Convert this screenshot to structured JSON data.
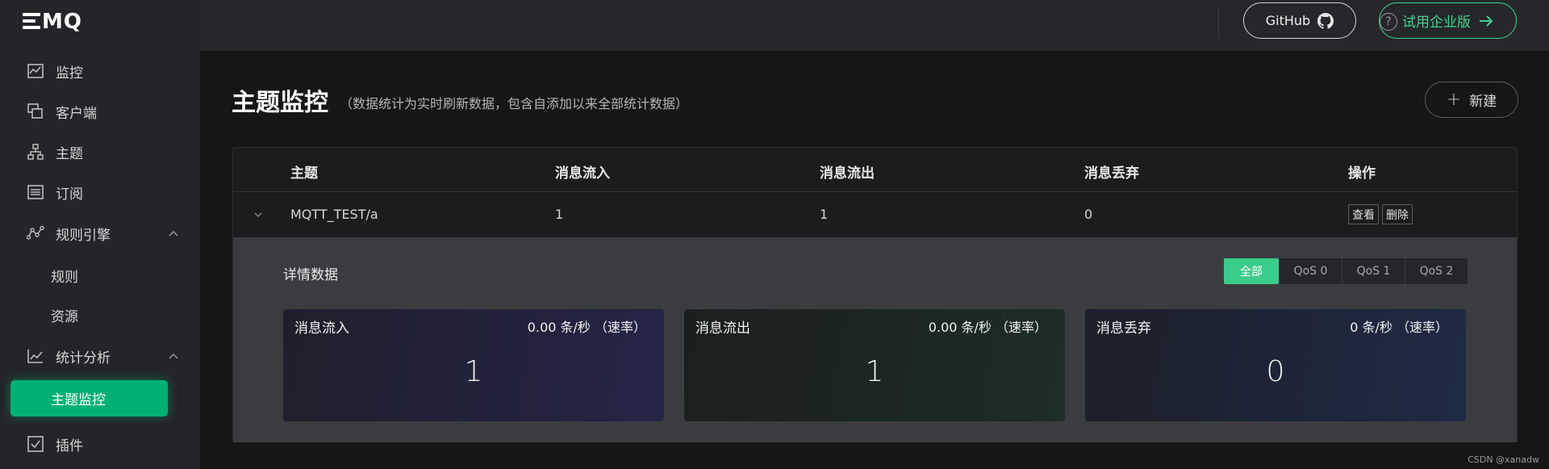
{
  "brand": {
    "logo_text": "MQ"
  },
  "sidebar": {
    "items": [
      {
        "label": "监控",
        "icon": "monitor-chart-icon"
      },
      {
        "label": "客户端",
        "icon": "clients-icon"
      },
      {
        "label": "主题",
        "icon": "topic-tree-icon"
      },
      {
        "label": "订阅",
        "icon": "subscription-list-icon"
      },
      {
        "label": "规则引擎",
        "icon": "rule-engine-icon",
        "expanded": true,
        "children": [
          {
            "label": "规则"
          },
          {
            "label": "资源"
          }
        ]
      },
      {
        "label": "统计分析",
        "icon": "statistics-chart-icon",
        "expanded": true,
        "children": [
          {
            "label": "主题监控",
            "active": true
          }
        ]
      },
      {
        "label": "插件",
        "icon": "plugin-checkbox-icon"
      }
    ]
  },
  "header": {
    "help_icon": "?",
    "github_label": "GitHub",
    "enterprise_label": "试用企业版"
  },
  "page": {
    "title": "主题监控",
    "subtitle": "（数据统计为实时刷新数据，包含自添加以来全部统计数据）",
    "new_button": "新建"
  },
  "table": {
    "columns": [
      "主题",
      "消息流入",
      "消息流出",
      "消息丢弃",
      "操作"
    ],
    "rows": [
      {
        "topic": "MQTT_TEST/a",
        "in": "1",
        "out": "1",
        "dropped": "0",
        "actions": [
          "查看",
          "删除"
        ]
      }
    ]
  },
  "detail": {
    "title": "详情数据",
    "qos_tabs": [
      "全部",
      "QoS 0",
      "QoS 1",
      "QoS 2"
    ],
    "selected_qos": "全部",
    "cards": [
      {
        "title": "消息流入",
        "rate": "0.00 条/秒 （速率）",
        "value": "1"
      },
      {
        "title": "消息流出",
        "rate": "0.00 条/秒 （速率）",
        "value": "1"
      },
      {
        "title": "消息丢弃",
        "rate": "0 条/秒 （速率）",
        "value": "0"
      }
    ]
  },
  "colors": {
    "accent": "#00b173",
    "accent_light": "#3ccc8a",
    "sidebar_bg": "#242529",
    "main_bg": "#161616",
    "card_in": "#262446",
    "card_out": "#1d2e26",
    "card_drop": "#1f2a44"
  },
  "watermark": "CSDN @xanadw"
}
